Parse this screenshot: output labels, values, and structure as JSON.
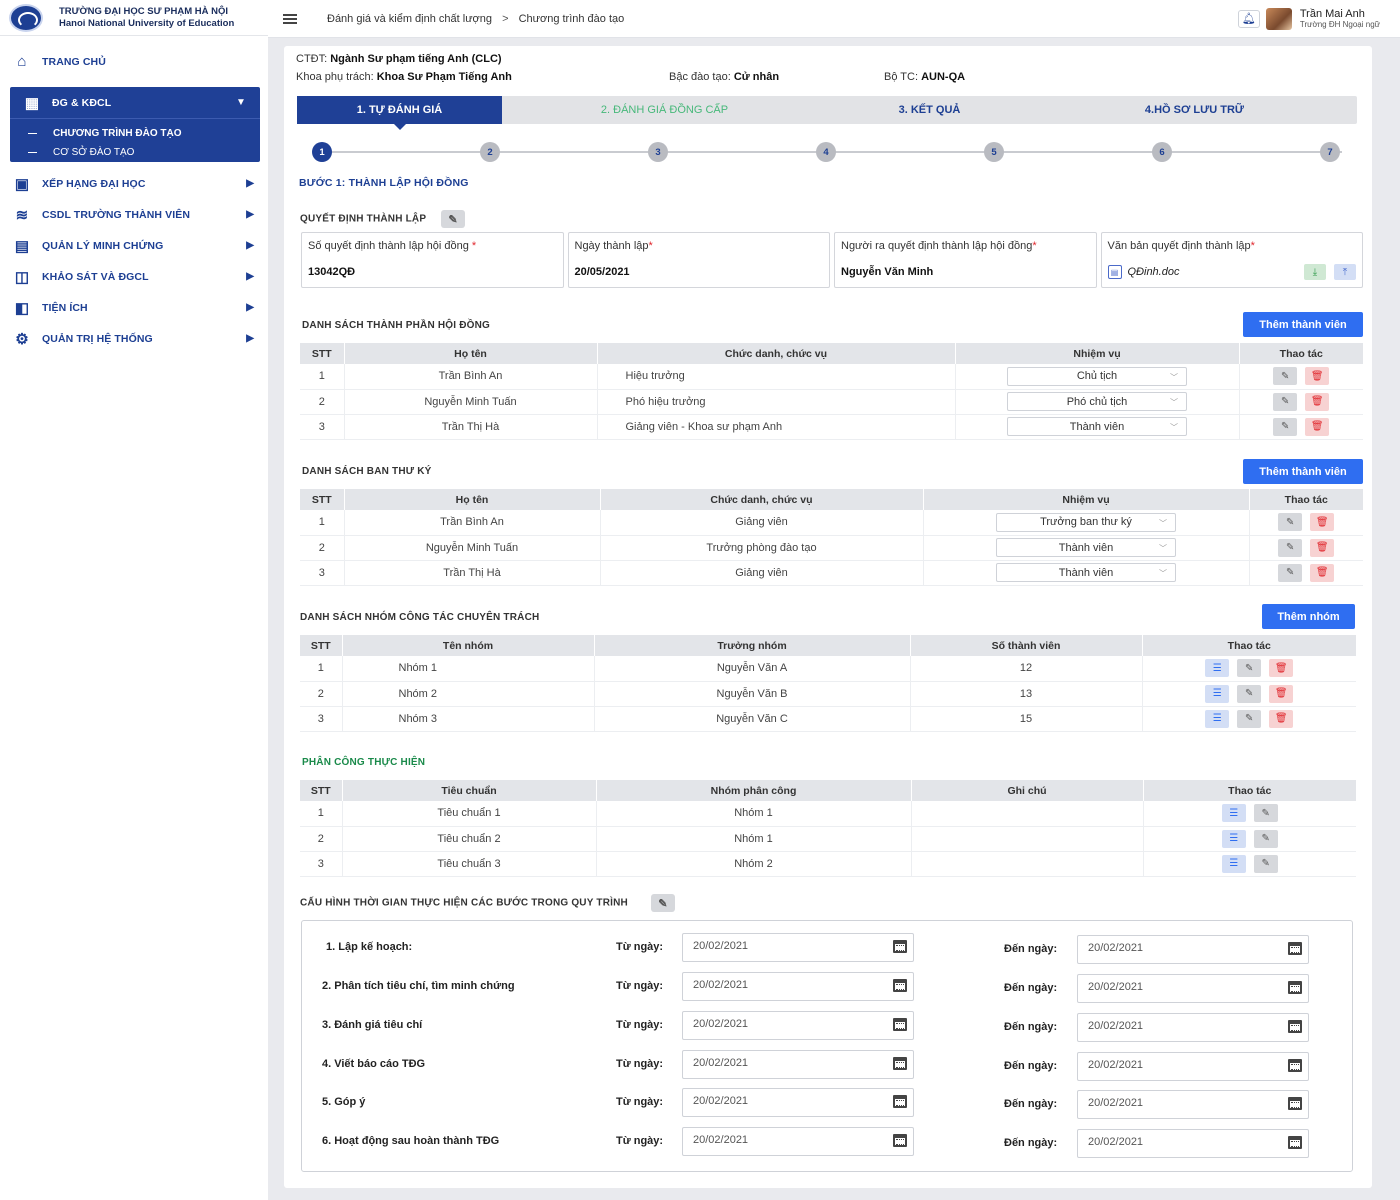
{
  "brand": {
    "line1": "TRƯỜNG ĐẠI HỌC SƯ PHẠM HÀ NỘI",
    "line2": "Hanoi National University of Education"
  },
  "sidebar": {
    "home": "TRANG CHỦ",
    "group": {
      "label": "ĐG & KĐCL",
      "subitems": [
        "CHƯƠNG TRÌNH ĐÀO TẠO",
        "CƠ SỞ ĐÀO TẠO"
      ]
    },
    "items": [
      {
        "label": "XẾP HẠNG ĐẠI HỌC",
        "icon": "calendar-star-icon"
      },
      {
        "label": "CSDL TRƯỜNG THÀNH VIÊN",
        "icon": "database-icon"
      },
      {
        "label": "QUẢN LÝ MINH CHỨNG",
        "icon": "table-icon"
      },
      {
        "label": "KHẢO SÁT VÀ ĐGCL",
        "icon": "survey-icon"
      },
      {
        "label": "TIỆN ÍCH",
        "icon": "utility-icon"
      },
      {
        "label": "QUẢN TRỊ HỆ THỐNG",
        "icon": "gear-icon"
      }
    ]
  },
  "topbar": {
    "breadcrumb": [
      "Đánh giá và kiểm định chất lượng",
      "Chương trình đào tạo"
    ],
    "breadcrumb_sep": ">",
    "user_name": "Trần Mai Anh",
    "user_role": "Trường ĐH Ngoại ngữ"
  },
  "program": {
    "ctdt_label": "CTĐT:",
    "ctdt_value": "Ngành Sư phạm tiếng Anh (CLC)",
    "faculty_label": "Khoa phụ trách:",
    "faculty_value": "Khoa Sư Phạm Tiếng Anh",
    "level_label": "Bậc đào tạo:",
    "level_value": "Cử nhân",
    "criteria_label": "Bộ TC:",
    "criteria_value": "AUN-QA"
  },
  "tabs": [
    "1. TỰ ĐÁNH GIÁ",
    "2. ĐÁNH GIÁ ĐỒNG CẤP",
    "3. KẾT QUẢ",
    "4.HỒ SƠ LƯU TRỮ"
  ],
  "steps": [
    "1",
    "2",
    "3",
    "4",
    "5",
    "6",
    "7"
  ],
  "step_title": "BƯỚC 1: THÀNH LẬP HỘI ĐỒNG",
  "decision": {
    "title": "QUYẾT ĐỊNH THÀNH LẬP",
    "required_mark": "*",
    "fields": [
      {
        "label": "Số quyết định thành lập hội đồng",
        "value": "13042QĐ"
      },
      {
        "label": "Ngày thành lập",
        "value": "20/05/2021"
      },
      {
        "label": "Người ra quyết định thành lập hội đồng",
        "value": "Nguyễn Văn Minh"
      },
      {
        "label": "Văn bản quyết định thành lập",
        "value": "QĐinh.doc"
      }
    ]
  },
  "council": {
    "title": "DANH SÁCH THÀNH PHẦN HỘI ĐỒNG",
    "add_button": "Thêm thành viên",
    "headers": [
      "STT",
      "Họ tên",
      "Chức danh, chức vụ",
      "Nhiệm vụ",
      "Thao tác"
    ],
    "rows": [
      {
        "stt": "1",
        "name": "Trần Bình An",
        "position": "Hiệu trưởng",
        "role": "Chủ tịch"
      },
      {
        "stt": "2",
        "name": "Nguyễn Minh Tuấn",
        "position": "Phó hiệu trưởng",
        "role": "Phó chủ tịch"
      },
      {
        "stt": "3",
        "name": "Trần Thị Hà",
        "position": "Giảng viên - Khoa sư phạm Anh",
        "role": "Thành viên"
      }
    ]
  },
  "secretary": {
    "title": "DANH SÁCH  BAN THƯ KÝ",
    "add_button": "Thêm thành viên",
    "headers": [
      "STT",
      "Họ tên",
      "Chức danh, chức vụ",
      "Nhiệm vụ",
      "Thao tác"
    ],
    "rows": [
      {
        "stt": "1",
        "name": "Trần Bình An",
        "position": "Giảng viên",
        "role": "Trưởng ban thư ký"
      },
      {
        "stt": "2",
        "name": "Nguyễn Minh Tuấn",
        "position": "Trưởng phòng đào tạo",
        "role": "Thành viên"
      },
      {
        "stt": "3",
        "name": "Trần Thị Hà",
        "position": "Giảng viên",
        "role": "Thành viên"
      }
    ]
  },
  "groups": {
    "title": "DANH SÁCH NHÓM CÔNG TÁC CHUYÊN TRÁCH",
    "add_button": "Thêm nhóm",
    "headers": [
      "STT",
      "Tên nhóm",
      "Trưởng nhóm",
      "Số thành viên",
      "Thao tác"
    ],
    "rows": [
      {
        "stt": "1",
        "name": "Nhóm 1",
        "leader": "Nguyễn Văn A",
        "members": "12"
      },
      {
        "stt": "2",
        "name": "Nhóm 2",
        "leader": "Nguyễn Văn B",
        "members": "13"
      },
      {
        "stt": "3",
        "name": "Nhóm 3",
        "leader": "Nguyễn Văn C",
        "members": "15"
      }
    ]
  },
  "assignment": {
    "title": "PHÂN CÔNG THỰC HIỆN",
    "headers": [
      "STT",
      "Tiêu chuẩn",
      "Nhóm phân công",
      "Ghi chú",
      "Thao tác"
    ],
    "rows": [
      {
        "stt": "1",
        "criterion": "Tiêu chuẩn 1",
        "group": "Nhóm 1",
        "note": ""
      },
      {
        "stt": "2",
        "criterion": "Tiêu chuẩn 2",
        "group": "Nhóm 1",
        "note": ""
      },
      {
        "stt": "3",
        "criterion": "Tiêu chuẩn 3",
        "group": "Nhóm 2",
        "note": ""
      }
    ]
  },
  "config": {
    "title": "CẤU HÌNH THỜI GIAN THỰC HIỆN CÁC BƯỚC TRONG QUY TRÌNH",
    "from_label": "Từ ngày:",
    "to_label": "Đến ngày:",
    "rows": [
      {
        "label": "1. Lập kế hoạch:",
        "from": "20/02/2021",
        "to": "20/02/2021"
      },
      {
        "label": "2. Phân tích tiêu chí, tìm minh chứng",
        "from": "20/02/2021",
        "to": "20/02/2021"
      },
      {
        "label": "3. Đánh giá tiêu chí",
        "from": "20/02/2021",
        "to": "20/02/2021"
      },
      {
        "label": "4. Viết báo cáo TĐG",
        "from": "20/02/2021",
        "to": "20/02/2021"
      },
      {
        "label": "5. Góp ý",
        "from": "20/02/2021",
        "to": "20/02/2021"
      },
      {
        "label": "6. Hoạt động sau hoàn thành TĐG",
        "from": "20/02/2021",
        "to": "20/02/2021"
      }
    ]
  },
  "colors": {
    "primary": "#1f4096",
    "button": "#2f6ef1",
    "success": "#47b87a",
    "danger": "#e0262c"
  }
}
